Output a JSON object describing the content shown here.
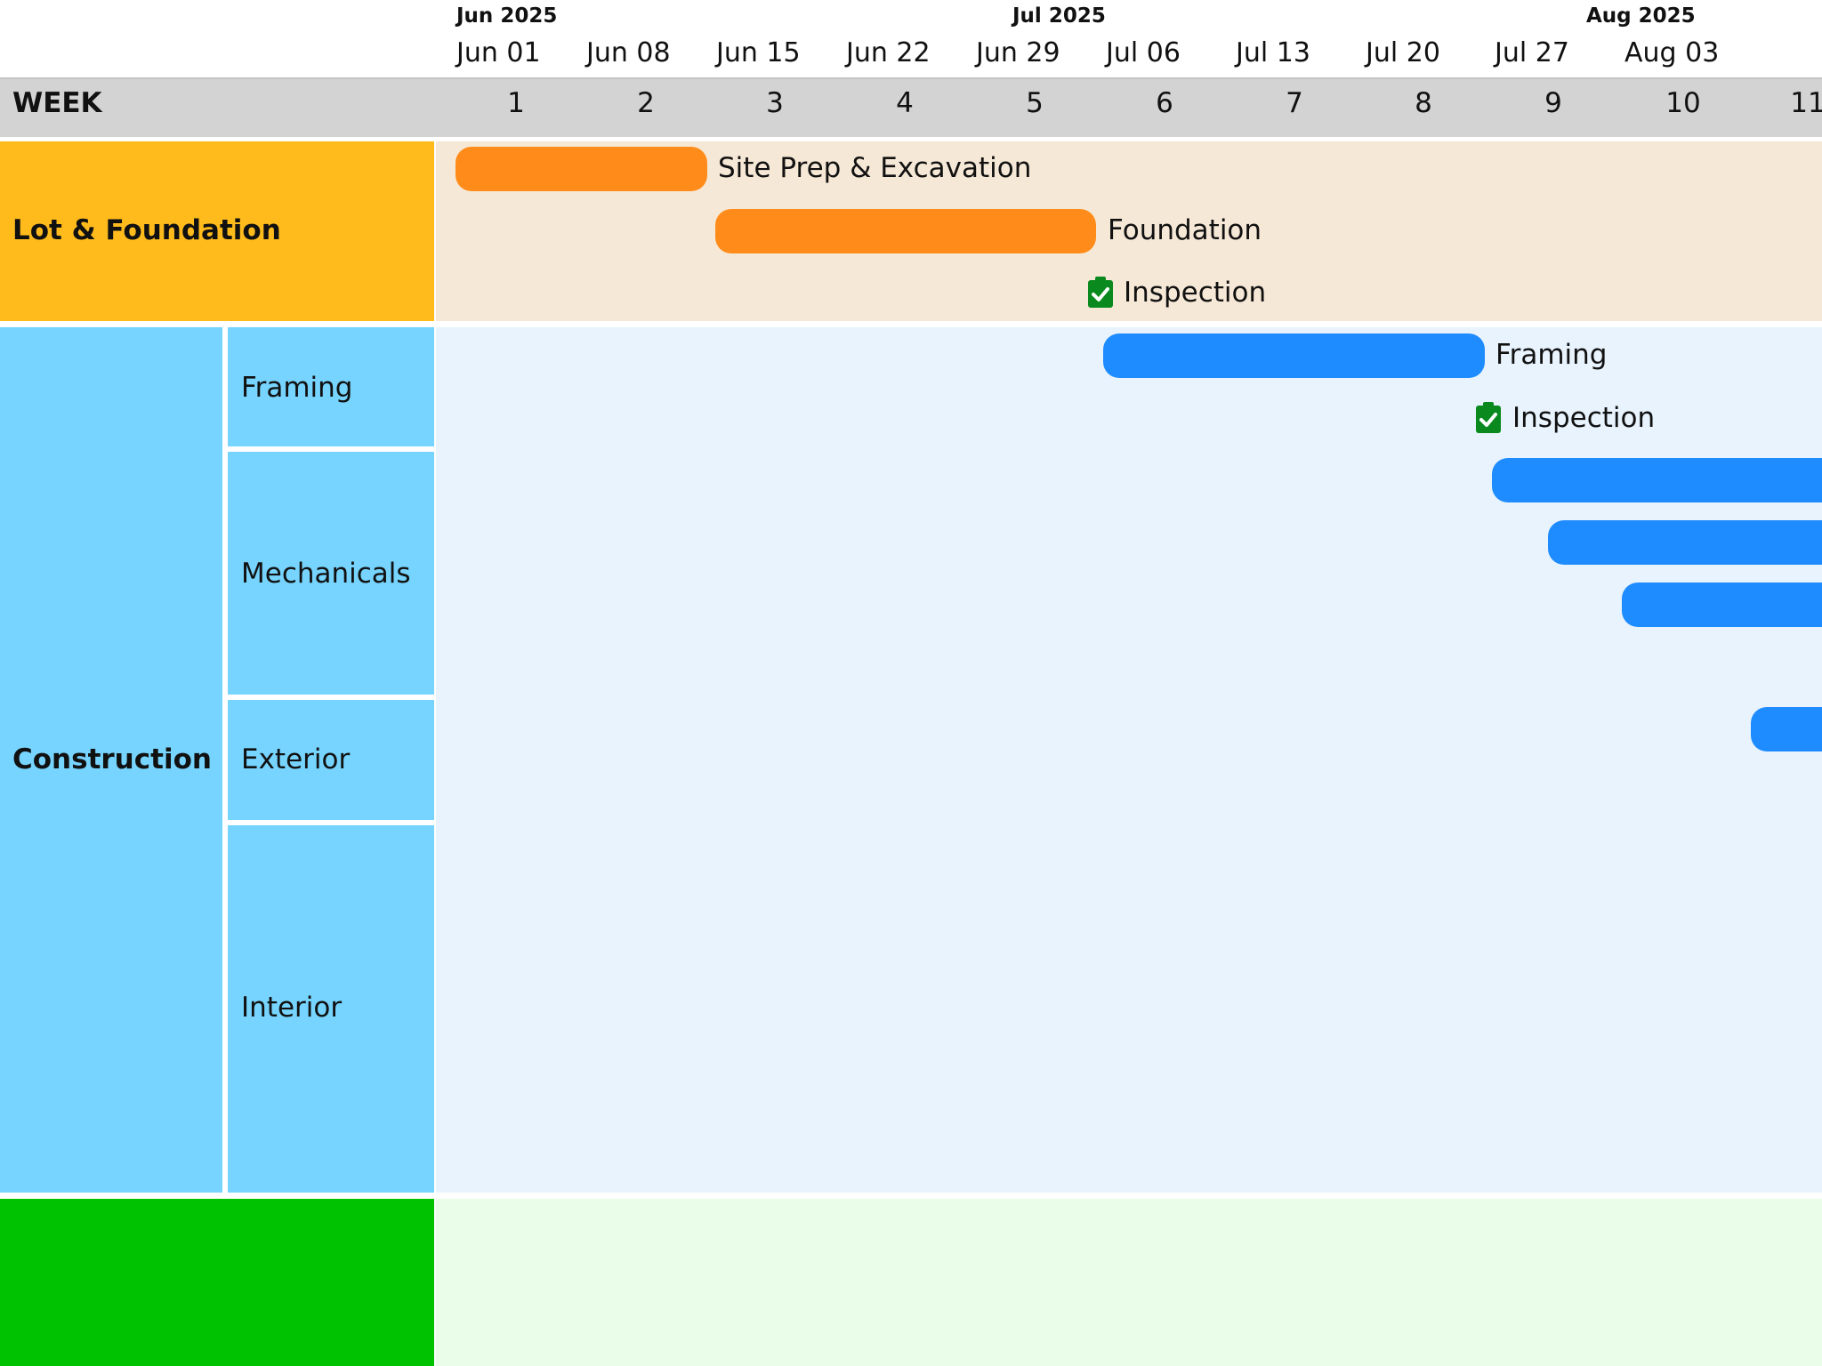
{
  "timeline": {
    "months": [
      "Jun 2025",
      "Jul 2025",
      "Aug 2025"
    ],
    "dates": [
      "Jun 01",
      "Jun 08",
      "Jun 15",
      "Jun 22",
      "Jun 29",
      "Jul 06",
      "Jul 13",
      "Jul 20",
      "Jul 27",
      "Aug 03"
    ],
    "week_title": "WEEK",
    "weeks": [
      "1",
      "2",
      "3",
      "4",
      "5",
      "6",
      "7",
      "8",
      "9",
      "10",
      "11"
    ]
  },
  "groups": {
    "lot": {
      "label": "Lot & Foundation",
      "color": "#ffbb1c",
      "band_color": "#f6e8d6"
    },
    "construction": {
      "label": "Construction",
      "color": "#76d4fe",
      "band_color": "#e8f3fd",
      "subgroups": [
        "Framing",
        "Mechanicals",
        "Exterior",
        "Interior"
      ]
    },
    "finish": {
      "label": "",
      "color": "#00c200",
      "band_color": "#e9fde9"
    }
  },
  "tasks": {
    "site_prep": "Site Prep & Excavation",
    "foundation": "Foundation",
    "inspection_1": "Inspection",
    "framing": "Framing",
    "inspection_2": "Inspection"
  },
  "colors": {
    "orange_bar": "#ff8c1a",
    "blue_bar": "#1e8cff",
    "milestone": "#0a8a1e"
  },
  "icons": {
    "milestone": "clipboard-check-icon"
  }
}
